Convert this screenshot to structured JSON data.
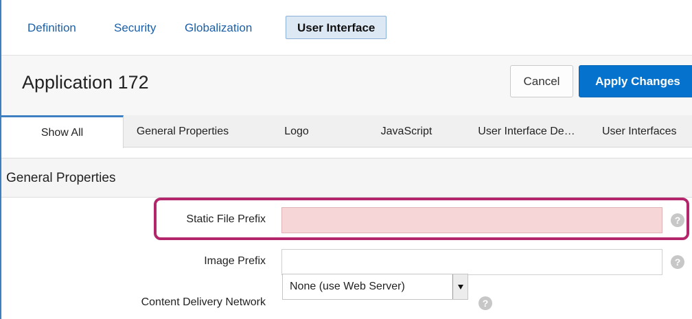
{
  "top_tabs": [
    {
      "label": "Definition"
    },
    {
      "label": "Security"
    },
    {
      "label": "Globalization"
    },
    {
      "label": "User Interface",
      "active": true
    }
  ],
  "header": {
    "title": "Application 172",
    "cancel_label": "Cancel",
    "apply_label": "Apply Changes"
  },
  "region_tabs": [
    {
      "label": "Show All",
      "active": true
    },
    {
      "label": "General Properties"
    },
    {
      "label": "Logo"
    },
    {
      "label": "JavaScript"
    },
    {
      "label": "User Interface De…"
    },
    {
      "label": "User Interfaces"
    }
  ],
  "section": {
    "title": "General Properties",
    "fields": [
      {
        "label": "Static File Prefix",
        "value": "",
        "highlighted": true
      },
      {
        "label": "Image Prefix",
        "value": ""
      },
      {
        "label": "Content Delivery Network",
        "selected": "None (use Web Server)"
      }
    ]
  },
  "help_glyph": "?",
  "colors": {
    "accent": "#0572ce",
    "link": "#1a5fa8",
    "highlight_ring": "#b3266b",
    "highlight_fill": "#f6d6d6"
  }
}
